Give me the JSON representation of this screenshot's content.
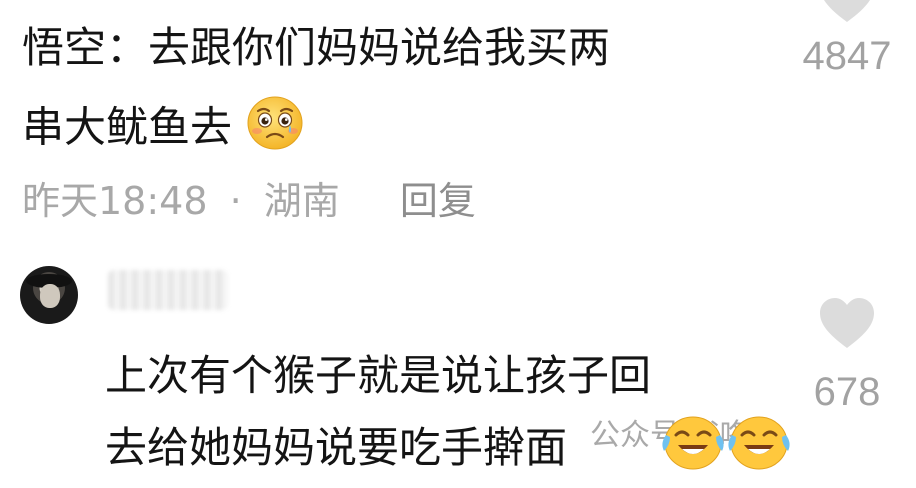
{
  "comment1": {
    "line1": "悟空：去跟你们妈妈说给我买两",
    "line2": "串大鱿鱼去",
    "emoji": "pleading-face-icon",
    "time": "昨天18:48",
    "separator": "·",
    "location": "湖南",
    "reply_label": "回复",
    "like_count": "4847"
  },
  "comment2": {
    "line1": "上次有个猴子就是说让孩子回",
    "line2": "去给她妈妈说要吃手擀面",
    "emojis": [
      "tears-of-joy-icon",
      "tears-of-joy-icon"
    ],
    "like_count": "678"
  },
  "watermark": {
    "text": "公众号·书咚咚"
  },
  "colors": {
    "text": "#141414",
    "meta": "#a8a8a8",
    "like": "#a2a2a2",
    "heart": "#dcdcdc",
    "emoji_yellow": "#ffc83d"
  }
}
